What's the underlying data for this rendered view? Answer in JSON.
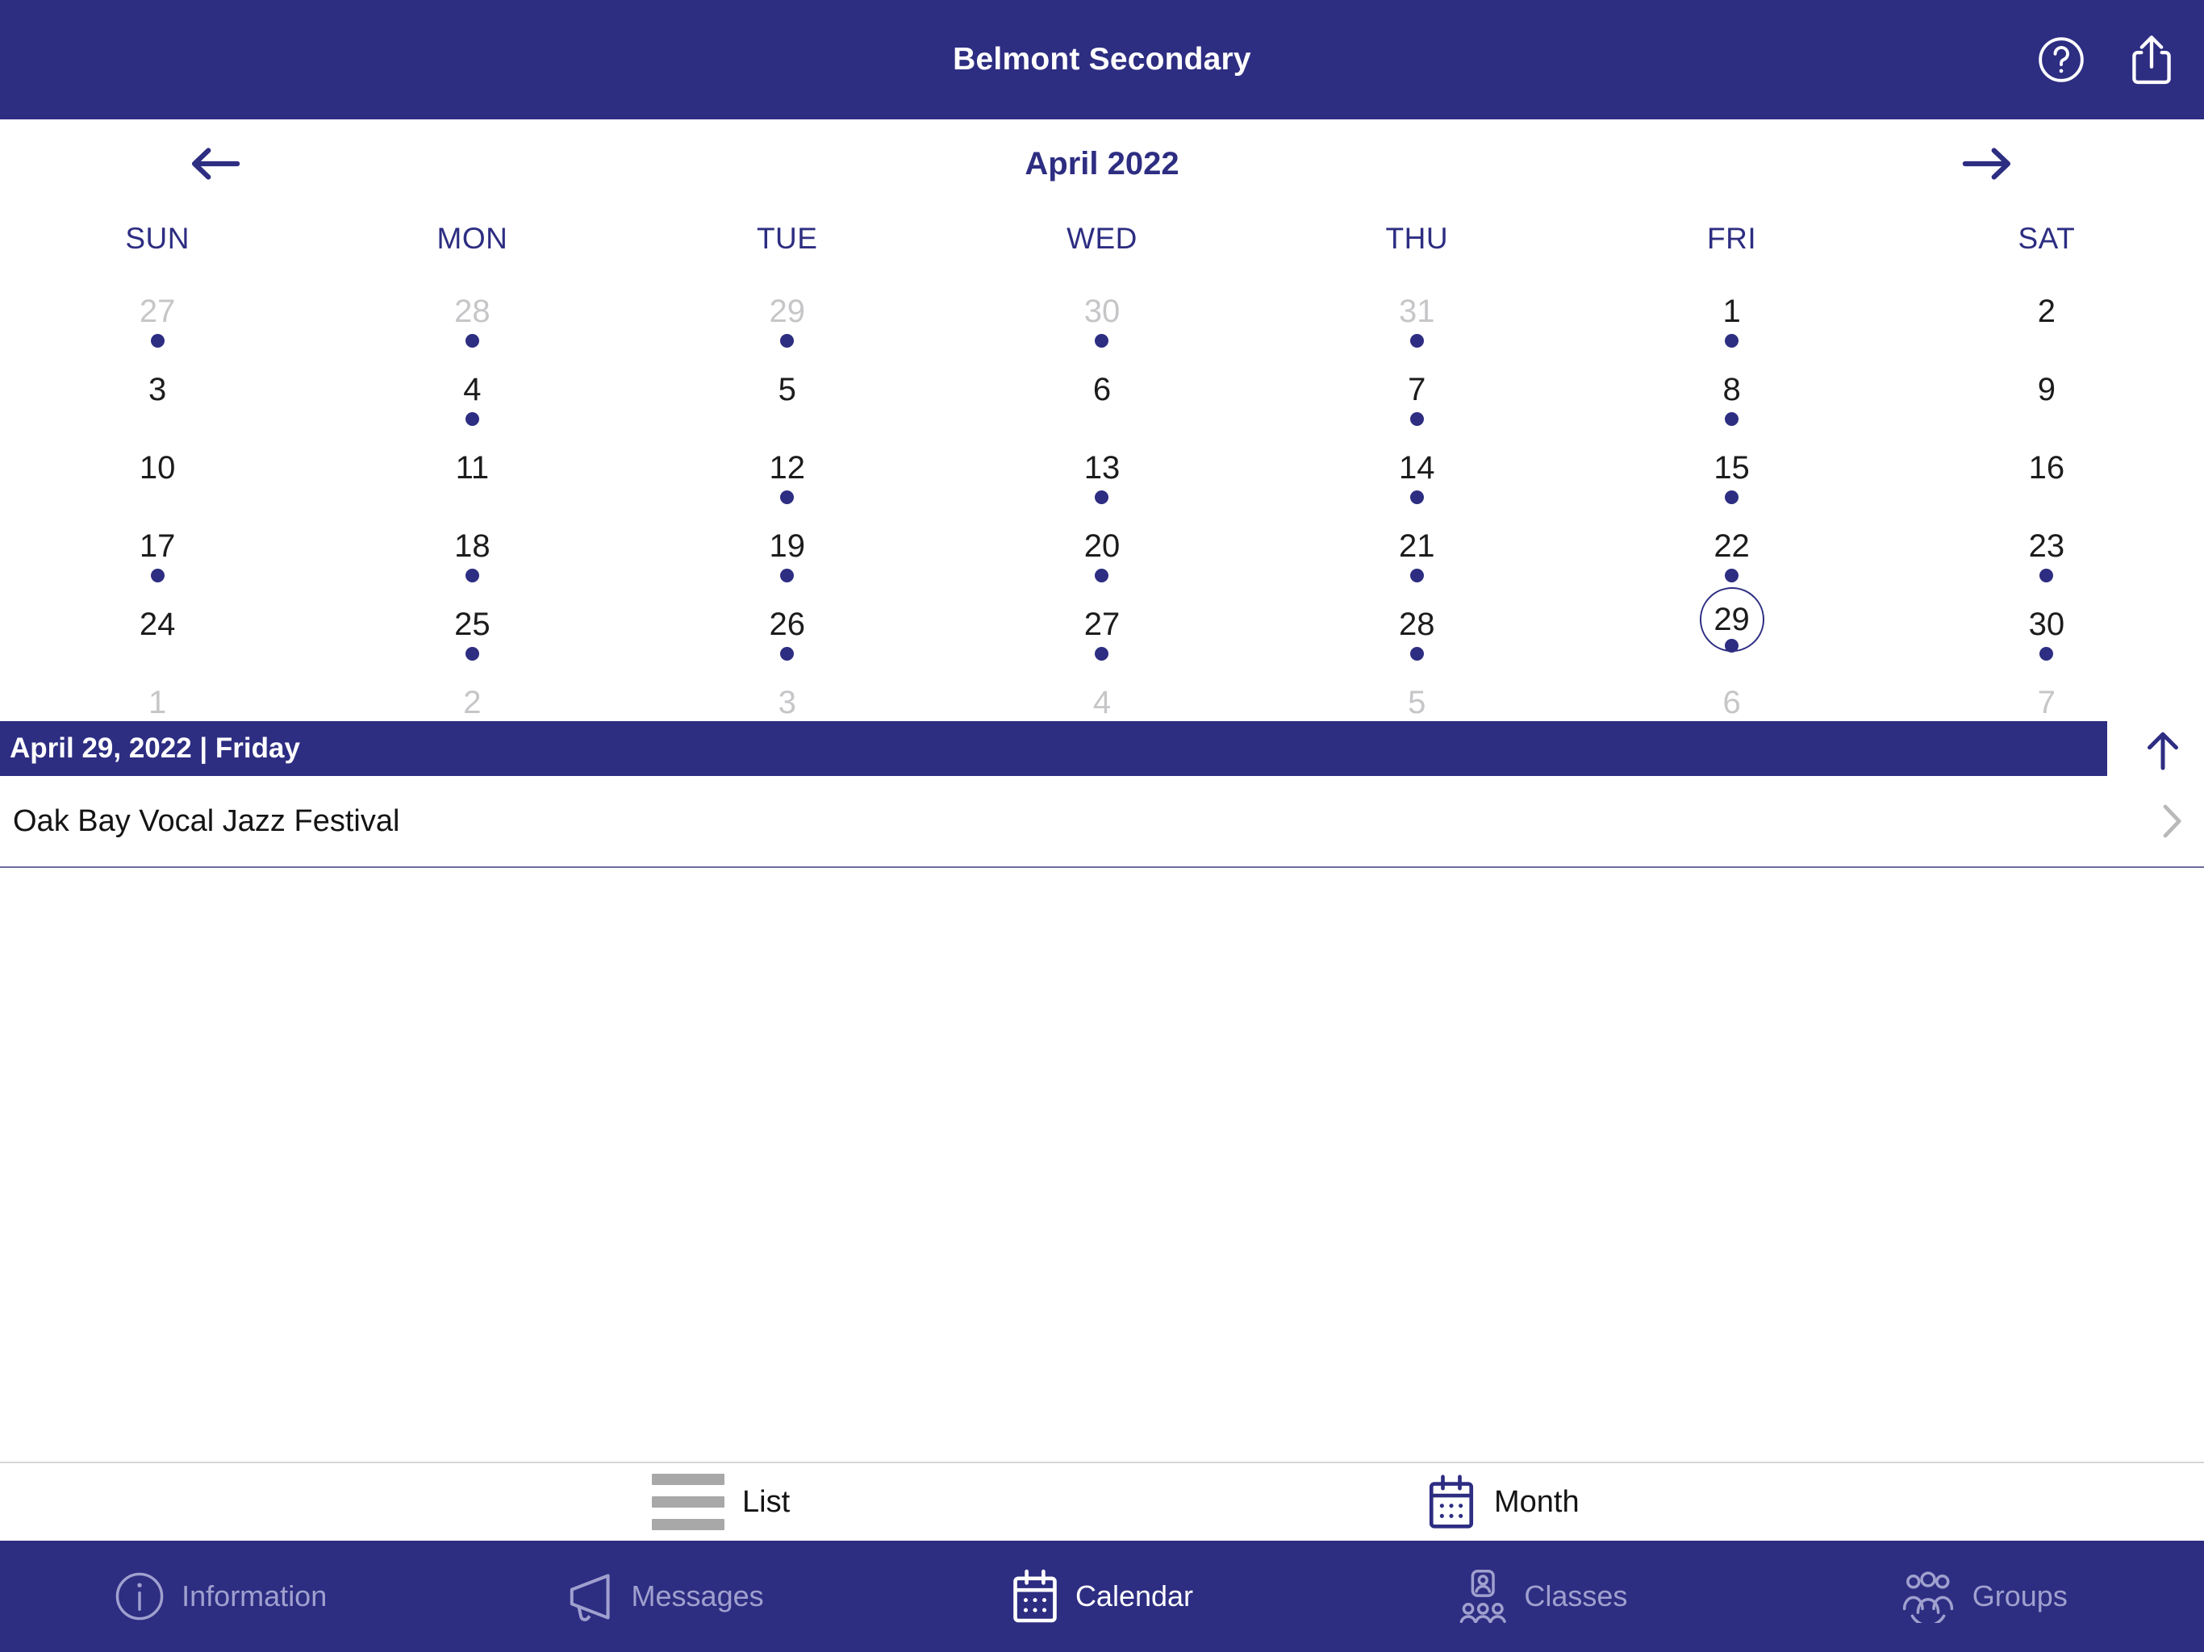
{
  "header": {
    "title": "Belmont Secondary",
    "help_icon": "help-circle-icon",
    "share_icon": "share-icon"
  },
  "calendar": {
    "month_label": "April 2022",
    "prev_label": "←",
    "next_label": "→",
    "weekdays": [
      "SUN",
      "MON",
      "TUE",
      "WED",
      "THU",
      "FRI",
      "SAT"
    ],
    "days": [
      {
        "n": "27",
        "muted": true,
        "dot": true,
        "sel": false
      },
      {
        "n": "28",
        "muted": true,
        "dot": true,
        "sel": false
      },
      {
        "n": "29",
        "muted": true,
        "dot": true,
        "sel": false
      },
      {
        "n": "30",
        "muted": true,
        "dot": true,
        "sel": false
      },
      {
        "n": "31",
        "muted": true,
        "dot": true,
        "sel": false
      },
      {
        "n": "1",
        "muted": false,
        "dot": true,
        "sel": false
      },
      {
        "n": "2",
        "muted": false,
        "dot": false,
        "sel": false
      },
      {
        "n": "3",
        "muted": false,
        "dot": false,
        "sel": false
      },
      {
        "n": "4",
        "muted": false,
        "dot": true,
        "sel": false
      },
      {
        "n": "5",
        "muted": false,
        "dot": false,
        "sel": false
      },
      {
        "n": "6",
        "muted": false,
        "dot": false,
        "sel": false
      },
      {
        "n": "7",
        "muted": false,
        "dot": true,
        "sel": false
      },
      {
        "n": "8",
        "muted": false,
        "dot": true,
        "sel": false
      },
      {
        "n": "9",
        "muted": false,
        "dot": false,
        "sel": false
      },
      {
        "n": "10",
        "muted": false,
        "dot": false,
        "sel": false
      },
      {
        "n": "11",
        "muted": false,
        "dot": false,
        "sel": false
      },
      {
        "n": "12",
        "muted": false,
        "dot": true,
        "sel": false
      },
      {
        "n": "13",
        "muted": false,
        "dot": true,
        "sel": false
      },
      {
        "n": "14",
        "muted": false,
        "dot": true,
        "sel": false
      },
      {
        "n": "15",
        "muted": false,
        "dot": true,
        "sel": false
      },
      {
        "n": "16",
        "muted": false,
        "dot": false,
        "sel": false
      },
      {
        "n": "17",
        "muted": false,
        "dot": true,
        "sel": false
      },
      {
        "n": "18",
        "muted": false,
        "dot": true,
        "sel": false
      },
      {
        "n": "19",
        "muted": false,
        "dot": true,
        "sel": false
      },
      {
        "n": "20",
        "muted": false,
        "dot": true,
        "sel": false
      },
      {
        "n": "21",
        "muted": false,
        "dot": true,
        "sel": false
      },
      {
        "n": "22",
        "muted": false,
        "dot": true,
        "sel": false
      },
      {
        "n": "23",
        "muted": false,
        "dot": true,
        "sel": false
      },
      {
        "n": "24",
        "muted": false,
        "dot": false,
        "sel": false
      },
      {
        "n": "25",
        "muted": false,
        "dot": true,
        "sel": false
      },
      {
        "n": "26",
        "muted": false,
        "dot": true,
        "sel": false
      },
      {
        "n": "27",
        "muted": false,
        "dot": true,
        "sel": false
      },
      {
        "n": "28",
        "muted": false,
        "dot": true,
        "sel": false
      },
      {
        "n": "29",
        "muted": false,
        "dot": true,
        "sel": true
      },
      {
        "n": "30",
        "muted": false,
        "dot": true,
        "sel": false
      },
      {
        "n": "1",
        "muted": true,
        "dot": false,
        "sel": false
      },
      {
        "n": "2",
        "muted": true,
        "dot": true,
        "sel": false
      },
      {
        "n": "3",
        "muted": true,
        "dot": false,
        "sel": false
      },
      {
        "n": "4",
        "muted": true,
        "dot": false,
        "sel": false
      },
      {
        "n": "5",
        "muted": true,
        "dot": false,
        "sel": false
      },
      {
        "n": "6",
        "muted": true,
        "dot": false,
        "sel": false
      },
      {
        "n": "7",
        "muted": true,
        "dot": false,
        "sel": false
      }
    ]
  },
  "selected_date": {
    "banner_text": "April 29, 2022 | Friday",
    "collapse_icon": "arrow-up-icon"
  },
  "events": [
    {
      "title": "Oak Bay Vocal Jazz Festival",
      "chevron": "chevron-right-icon"
    }
  ],
  "view_switcher": {
    "list_label": "List",
    "list_icon": "list-icon",
    "month_label": "Month",
    "month_icon": "calendar-icon",
    "active": "Month"
  },
  "tabbar": {
    "items": [
      {
        "label": "Information",
        "icon": "info-circle-icon",
        "active": false
      },
      {
        "label": "Messages",
        "icon": "megaphone-icon",
        "active": false
      },
      {
        "label": "Calendar",
        "icon": "calendar-icon",
        "active": true
      },
      {
        "label": "Classes",
        "icon": "classes-icon",
        "active": false
      },
      {
        "label": "Groups",
        "icon": "groups-icon",
        "active": false
      }
    ]
  },
  "colors": {
    "brand_blue": "#2d2d82",
    "muted_day": "#c6c6c9",
    "inactive_tab": "#a0a0cf",
    "list_icon_gray": "#a8a8a8"
  }
}
